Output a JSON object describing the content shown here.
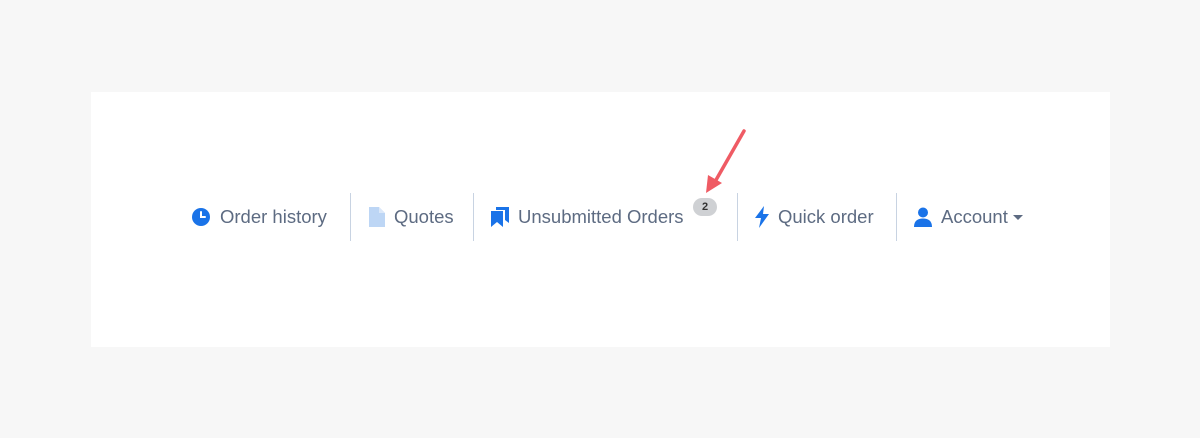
{
  "nav": {
    "items": [
      {
        "label": "Order history",
        "icon": "clock-icon"
      },
      {
        "label": "Quotes",
        "icon": "document-icon"
      },
      {
        "label": "Unsubmitted Orders",
        "icon": "bookmarks-icon",
        "badge": "2"
      },
      {
        "label": "Quick order",
        "icon": "lightning-bolt-icon"
      },
      {
        "label": "Account",
        "icon": "user-icon",
        "dropdown_icon": "caret-down-icon"
      }
    ]
  },
  "colors": {
    "page_background": "#f7f7f7",
    "card_background": "#ffffff",
    "nav_text": "#5d6b82",
    "icon_blue": "#1a73e8",
    "icon_light_blue": "#bdd6f5",
    "divider": "#c8d3e2",
    "badge_background": "#cfd1d4",
    "annotation_arrow": "#ef5b64"
  },
  "annotation": {
    "icon": "red-arrow-icon"
  }
}
